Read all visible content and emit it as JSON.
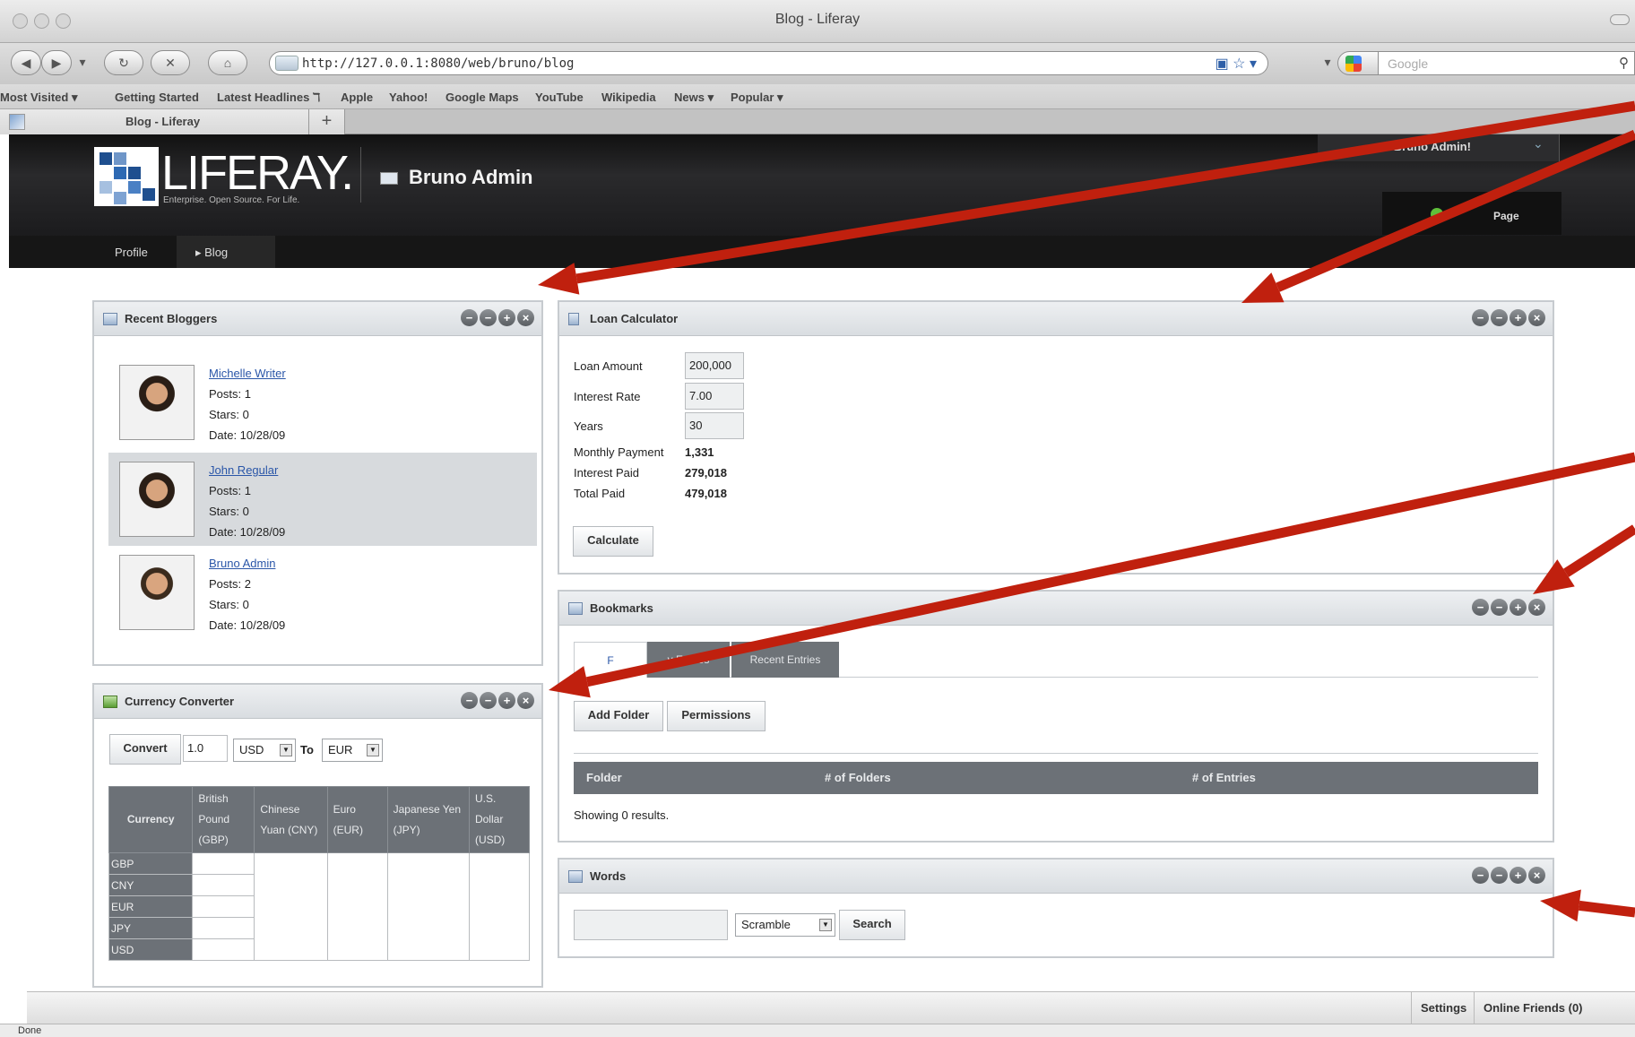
{
  "browser": {
    "window_title": "Blog - Liferay",
    "url": "http://127.0.0.1:8080/web/bruno/blog",
    "search_placeholder": "Google",
    "bookmarks": [
      "Most Visited ▾",
      "Getting Started",
      "Latest Headlines ℸ",
      "Apple",
      "Yahoo!",
      "Google Maps",
      "YouTube",
      "Wikipedia",
      "News ▾",
      "Popular ▾"
    ],
    "tab_title": "Blog - Liferay",
    "status": "Done"
  },
  "site": {
    "logo_text": "LIFERAY.",
    "tagline": "Enterprise. Open Source. For Life.",
    "community": "Bruno Admin",
    "welcome": "ne Bruno Admin!",
    "add_page": "Page",
    "nav": [
      {
        "label": "Profile"
      },
      {
        "label": "▸ Blog"
      }
    ]
  },
  "recent_bloggers": {
    "title": "Recent Bloggers",
    "items": [
      {
        "name": "Michelle Writer",
        "posts": "Posts: 1",
        "stars": "Stars: 0",
        "date": "Date: 10/28/09"
      },
      {
        "name": "John Regular",
        "posts": "Posts: 1",
        "stars": "Stars: 0",
        "date": "Date: 10/28/09"
      },
      {
        "name": "Bruno Admin",
        "posts": "Posts: 2",
        "stars": "Stars: 0",
        "date": "Date: 10/28/09"
      }
    ]
  },
  "loan_calculator": {
    "title": "Loan Calculator",
    "loan_amount_label": "Loan Amount",
    "loan_amount": "200,000",
    "interest_rate_label": "Interest Rate",
    "interest_rate": "7.00",
    "years_label": "Years",
    "years": "30",
    "monthly_payment_label": "Monthly Payment",
    "monthly_payment": "1,331",
    "interest_paid_label": "Interest Paid",
    "interest_paid": "279,018",
    "total_paid_label": "Total Paid",
    "total_paid": "479,018",
    "calculate": "Calculate"
  },
  "currency_converter": {
    "title": "Currency Converter",
    "convert": "Convert",
    "amount": "1.0",
    "from": "USD",
    "to_label": "To",
    "to": "EUR",
    "header": [
      "Currency",
      "British Pound (GBP)",
      "Chinese Yuan (CNY)",
      "Euro (EUR)",
      "Japanese Yen (JPY)",
      "U.S. Dollar (USD)"
    ],
    "rows": [
      "GBP",
      "CNY",
      "EUR",
      "JPY",
      "USD"
    ]
  },
  "bookmarks": {
    "title": "Bookmarks",
    "tabs": [
      "F",
      "y Entries",
      "Recent Entries"
    ],
    "add_folder": "Add Folder",
    "permissions": "Permissions",
    "columns": [
      "Folder",
      "# of Folders",
      "# of Entries"
    ],
    "results": "Showing 0 results."
  },
  "words": {
    "title": "Words",
    "input_value": "",
    "mode": "Scramble",
    "search": "Search"
  },
  "dock": {
    "settings": "Settings",
    "online_friends": "Online Friends (0)"
  },
  "portlet_controls": [
    "−",
    "−",
    "+",
    "×"
  ],
  "annotation_color": "#c0200e"
}
